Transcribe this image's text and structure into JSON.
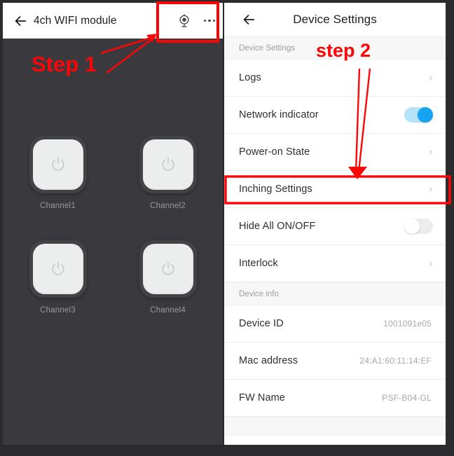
{
  "left_panel": {
    "appbar": {
      "back_icon": "back-arrow-icon",
      "title": "4ch WIFI module",
      "camera_icon": "webcam-icon",
      "overflow_icon": "more-options-icon"
    },
    "channels": [
      {
        "label": "Channel1",
        "icon": "power-icon",
        "state": "off"
      },
      {
        "label": "Channel2",
        "icon": "power-icon",
        "state": "off"
      },
      {
        "label": "Channel3",
        "icon": "power-icon",
        "state": "off"
      },
      {
        "label": "Channel4",
        "icon": "power-icon",
        "state": "off"
      }
    ]
  },
  "right_panel": {
    "appbar": {
      "back_icon": "back-arrow-icon",
      "title": "Device Settings"
    },
    "sections": [
      {
        "header": "Device Settings",
        "rows": [
          {
            "label": "Logs",
            "type": "chevron",
            "value": "",
            "chevron": "›",
            "highlighted": false
          },
          {
            "label": "Network indicator",
            "type": "toggle",
            "value": "",
            "toggle": "on",
            "highlighted": false
          },
          {
            "label": "Power-on State",
            "type": "chevron",
            "value": "",
            "chevron": "›",
            "highlighted": false
          },
          {
            "label": "Inching Settings",
            "type": "chevron",
            "value": "",
            "chevron": "›",
            "highlighted": true
          },
          {
            "label": "Hide All ON/OFF",
            "type": "toggle",
            "value": "",
            "toggle": "off",
            "highlighted": false
          },
          {
            "label": "Interlock",
            "type": "chevron",
            "value": "",
            "chevron": "›",
            "highlighted": false
          }
        ]
      },
      {
        "header": "Device info",
        "rows": [
          {
            "label": "Device ID",
            "type": "value",
            "value": "1001091e05",
            "chevron": "",
            "highlighted": false
          },
          {
            "label": "Mac address",
            "type": "value",
            "value": "24:A1:60:11:14:EF",
            "chevron": "",
            "highlighted": false
          },
          {
            "label": "FW Name",
            "type": "value",
            "value": "PSF-B04-GL",
            "chevron": "",
            "highlighted": false
          }
        ]
      }
    ]
  },
  "annotations": {
    "step1": "Step 1",
    "step2": "step 2",
    "accent_color": "#fb0606"
  },
  "colors": {
    "panel_dark": "#3a3a3e",
    "channel_tile": "#424247",
    "channel_button": "#eceded",
    "toggle_on_track": "#b6e2fb",
    "toggle_on_knob": "#15a4f0",
    "toggle_off_track": "#ececec",
    "annotation_red": "#fb0606",
    "section_band": "#f7f7f7"
  }
}
